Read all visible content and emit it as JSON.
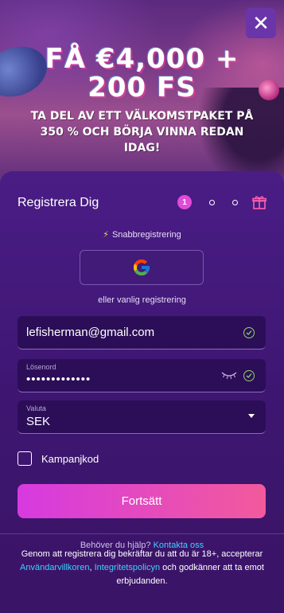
{
  "hero": {
    "title_line1": "FÅ €4,000 +",
    "title_line2": "200 FS",
    "subtitle": "TA DEL AV ETT VÄLKOMSTPAKET PÅ 350 % OCH BÖRJA VINNA REDAN IDAG!",
    "close_label": "✕"
  },
  "form": {
    "title": "Registrera Dig",
    "step_current": "1",
    "quick_label": "Snabbregistrering",
    "or_label": "eller vanlig registrering",
    "email_value": "lefisherman@gmail.com",
    "password_label": "Lösenord",
    "password_value": "•••••••••••••",
    "currency_label": "Valuta",
    "currency_value": "SEK",
    "promo_label": "Kampanjkod",
    "submit_label": "Fortsätt"
  },
  "footer": {
    "help_text": "Behöver du hjälp?",
    "help_link": "Kontakta oss",
    "terms_prefix": "Genom att registrera dig bekräftar du att du är 18+, accepterar",
    "terms_link1": "Användarvillkoren",
    "terms_sep": ",",
    "terms_link2": "Integritetspolicyn",
    "terms_suffix": "och godkänner att ta emot erbjudanden."
  },
  "colors": {
    "accent": "#e04bd8",
    "button_start": "#d63ae0",
    "button_end": "#f25a9c",
    "link": "#3ed2ff",
    "valid": "#8fd46a"
  },
  "icons": [
    "close-icon",
    "gift-icon",
    "bolt-icon",
    "google-icon",
    "check-icon",
    "eye-closed-icon",
    "chevron-down-icon"
  ]
}
